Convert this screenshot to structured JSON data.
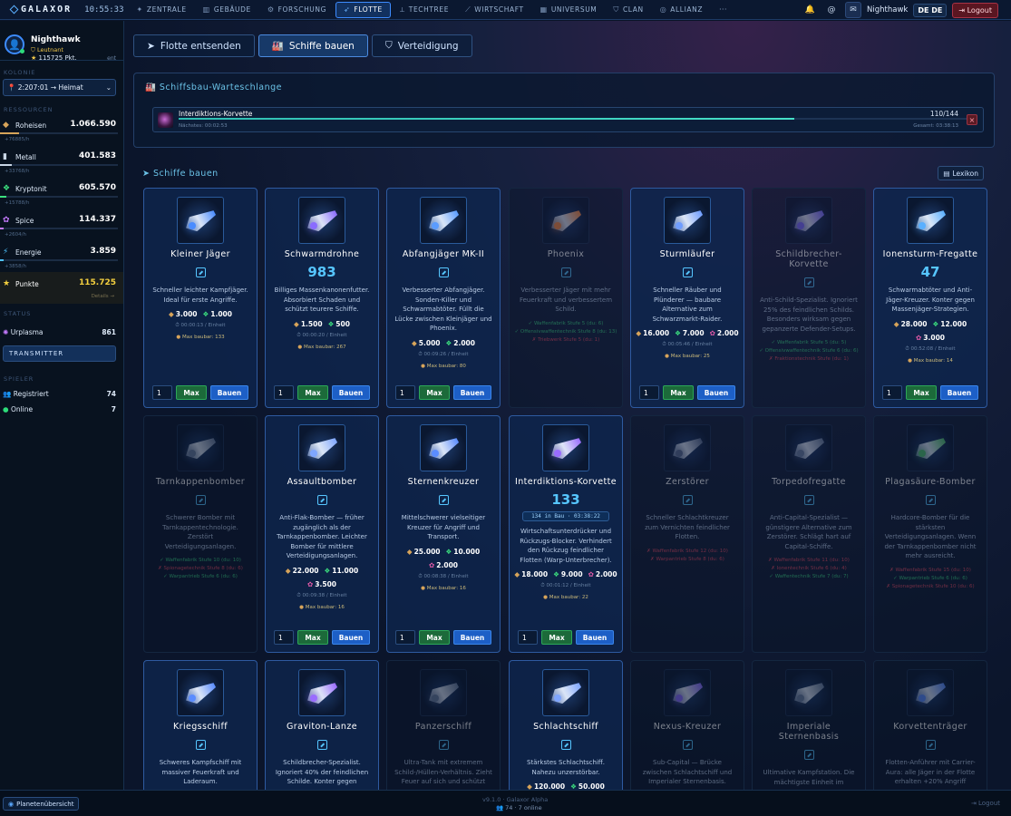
{
  "topbar": {
    "logo": "GALAXOR",
    "clock": "10:55:33",
    "nav": [
      {
        "label": "ZENTRALE",
        "icon": "radar-icon"
      },
      {
        "label": "GEBÄUDE",
        "icon": "building-icon"
      },
      {
        "label": "FORSCHUNG",
        "icon": "gear-icon"
      },
      {
        "label": "FLOTTE",
        "icon": "rocket-icon",
        "active": true
      },
      {
        "label": "TECHTREE",
        "icon": "techtree-icon"
      },
      {
        "label": "WIRTSCHAFT",
        "icon": "chart-icon"
      },
      {
        "label": "UNIVERSUM",
        "icon": "grid-icon"
      },
      {
        "label": "CLAN",
        "icon": "shield-icon"
      },
      {
        "label": "ALLIANZ",
        "icon": "globe-icon"
      }
    ],
    "more": "···",
    "username": "Nighthawk",
    "lang": "DE DE",
    "logout": "Logout"
  },
  "sidebar": {
    "player": {
      "name": "Nighthawk",
      "rank": "Leutnant",
      "points": "115725 Pkt.",
      "exp": "ent"
    },
    "colony_label": "KOLONIE",
    "colony": "2:207:01 → Heimat",
    "resources_label": "RESSOURCEN",
    "resources": [
      {
        "name": "Roheisen",
        "value": "1.066.590",
        "rate": "+76885/h",
        "fill": 0.16,
        "color": "#d7a45a"
      },
      {
        "name": "Metall",
        "value": "401.583",
        "rate": "+33768/h",
        "fill": 0.1,
        "color": "#c9d6e5"
      },
      {
        "name": "Kryptonit",
        "value": "605.570",
        "rate": "+15788/h",
        "fill": 0.05,
        "color": "#3ce07f"
      },
      {
        "name": "Spice",
        "value": "114.337",
        "rate": "+2604/h",
        "fill": 0.03,
        "color": "#c57bff"
      },
      {
        "name": "Energie",
        "value": "3.859",
        "rate": "+3858/h",
        "fill": 0.03,
        "color": "#4fc3ff"
      },
      {
        "name": "Punkte",
        "value": "115.725",
        "rate": "",
        "bonus": "Details →",
        "fill": 0,
        "color": "#f4d03f"
      }
    ],
    "status_label": "STATUS",
    "urplasma": {
      "name": "Urplasma",
      "value": "861"
    },
    "transmitter": "TRANSMITTER",
    "spieler_label": "SPIELER",
    "registered": {
      "label": "Registriert",
      "value": "74"
    },
    "online": {
      "label": "Online",
      "value": "7"
    }
  },
  "footer": {
    "planet_btn": "Planetenübersicht",
    "version": "v9.1.0 · Galaxor Alpha",
    "online": "74 · 7 online",
    "logout": "Logout"
  },
  "main": {
    "tabs": [
      "Flotte entsenden",
      "Schiffe bauen",
      "Verteidigung"
    ],
    "queue": {
      "title": "Schiffsbau-Warteschlange",
      "name": "Interdiktions-Korvette",
      "next": "Nächstes: 00:02:53",
      "count": "110/144",
      "total": "Gesamt: 03:38:13",
      "progress": 0.78
    },
    "ships_title": "Schiffe bauen",
    "lexikon": "Lexikon",
    "ships": [
      {
        "name": "Kleiner Jäger",
        "count": "0",
        "desc": "Schneller leichter Kampfjäger. Ideal für erste Angriffe.",
        "costs": [
          "3.000",
          "1.000"
        ],
        "time": "00:00:13 / Einheit",
        "max": "Max baubar: 133",
        "build": true,
        "locked": false,
        "hue": "#4a8cff"
      },
      {
        "name": "Schwarmdrohne",
        "count": "983",
        "desc": "Billiges Massenkanonenfutter. Absorbiert Schaden und schützt teurere Schiffe.",
        "costs": [
          "1.500",
          "500"
        ],
        "time": "00:00:20 / Einheit",
        "max": "Max baubar: 267",
        "build": true,
        "locked": false,
        "hue": "#8a6cff"
      },
      {
        "name": "Abfangjäger MK-II",
        "count": "0",
        "desc": "Verbesserter Abfangjäger. Sonden-Killer und Schwarmabtöter. Füllt die Lücke zwischen Kleinjäger und Phoenix.",
        "costs": [
          "5.000",
          "2.000"
        ],
        "time": "00:09:26 / Einheit",
        "max": "Max baubar: 80",
        "build": true,
        "locked": false,
        "hue": "#5a9cff"
      },
      {
        "name": "Phoenix",
        "count": "0",
        "desc": "Verbesserter Jäger mit mehr Feuerkraft und verbessertem Schild.",
        "reqs": [
          {
            "t": "✓ Waffenfabrik Stufe 5 (du: 6)",
            "ok": true
          },
          {
            "t": "✓ Offensivwaffentechnik Stufe 8 (du: 13)",
            "ok": true
          },
          {
            "t": "✗ Triebwerk Stufe 5 (du: 1)",
            "ok": false
          }
        ],
        "locked": true,
        "hue": "#ff8a3c"
      },
      {
        "name": "Sturmläufer",
        "count": "0",
        "desc": "Schneller Räuber und Plünderer — baubare Alternative zum Schwarzmarkt-Raider.",
        "costs": [
          "16.000",
          "7.000",
          "2.000"
        ],
        "time": "00:05:46 / Einheit",
        "max": "Max baubar: 25",
        "build": true,
        "locked": false,
        "hue": "#6f9dff"
      },
      {
        "name": "Schildbrecher-Korvette",
        "count": "0",
        "desc": "Anti-Schild-Spezialist. Ignoriert 25% des feindlichen Schilds. Besonders wirksam gegen gepanzerte Defender-Setups.",
        "reqs": [
          {
            "t": "✓ Waffenfabrik Stufe 5 (du: 5)",
            "ok": true
          },
          {
            "t": "✓ Offensivwaffentechnik Stufe 6 (du: 6)",
            "ok": true
          },
          {
            "t": "✗ Fraktionstechnik Stufe (du: 1)",
            "ok": false
          }
        ],
        "locked": true,
        "hue": "#7a6cff"
      },
      {
        "name": "Ionensturm-Fregatte",
        "count": "47",
        "desc": "Schwarmabtöter und Anti-Jäger-Kreuzer. Konter gegen Massenjäger-Strategien.",
        "costs": [
          "28.000",
          "12.000",
          "3.000"
        ],
        "time": "00:52:08 / Einheit",
        "max": "Max baubar: 14",
        "build": true,
        "locked": false,
        "hue": "#5ab0ff"
      },
      {
        "name": "Tarnkappenbomber",
        "count": "0",
        "desc": "Schwerer Bomber mit Tarnkappentechnologie. Zerstört Verteidigungsanlagen.",
        "reqs": [
          {
            "t": "✓ Waffenfabrik Stufe 10 (du: 10)",
            "ok": true
          },
          {
            "t": "✗ Spionagetechnik Stufe 8 (du: 6)",
            "ok": false
          },
          {
            "t": "✓ Warpantrieb Stufe 6 (du: 6)",
            "ok": true
          }
        ],
        "locked": true,
        "hue": "#6b7e9f"
      },
      {
        "name": "Assaultbomber",
        "count": "0",
        "desc": "Anti-Flak-Bomber — früher zugänglich als der Tarnkappenbomber. Leichter Bomber für mittlere Verteidigungsanlagen.",
        "costs": [
          "22.000",
          "11.000",
          "3.500"
        ],
        "time": "00:09:38 / Einheit",
        "max": "Max baubar: 16",
        "build": true,
        "locked": false,
        "hue": "#7fa6ff"
      },
      {
        "name": "Sternenkreuzer",
        "count": "0",
        "desc": "Mittelschwerer vielseitiger Kreuzer für Angriff und Transport.",
        "costs": [
          "25.000",
          "10.000",
          "2.000"
        ],
        "time": "00:08:38 / Einheit",
        "max": "Max baubar: 16",
        "build": true,
        "locked": false,
        "hue": "#5a8cff"
      },
      {
        "name": "Interdiktions-Korvette",
        "count": "133",
        "timer": "134 in Bau · 03:38:22",
        "desc": "Wirtschaftsunterdrücker und Rückzugs-Blocker. Verhindert den Rückzug feindlicher Flotten (Warp-Unterbrecher).",
        "costs": [
          "18.000",
          "9.000",
          "2.000"
        ],
        "time": "00:01:12 / Einheit",
        "max": "Max baubar: 22",
        "build": true,
        "locked": false,
        "hue": "#9a6cff"
      },
      {
        "name": "Zerstörer",
        "count": "0",
        "desc": "Schneller Schlachtkreuzer zum Vernichten feindlicher Flotten.",
        "reqs": [
          {
            "t": "✗ Waffenfabrik Stufe 12 (du: 10)",
            "ok": false
          },
          {
            "t": "✗ Warpantrieb Stufe 8 (du: 6)",
            "ok": false
          }
        ],
        "locked": true,
        "hue": "#5a6c8f"
      },
      {
        "name": "Torpedofregatte",
        "count": "0",
        "desc": "Anti-Capital-Spezialist — günstigere Alternative zum Zerstörer. Schlägt hart auf Capital-Schiffe.",
        "reqs": [
          {
            "t": "✗ Waffenfabrik Stufe 11 (du: 10)",
            "ok": false
          },
          {
            "t": "✗ Ionentechnik Stufe 6 (du: 4)",
            "ok": false
          },
          {
            "t": "✓ Waffentechnik Stufe 7 (du: 7)",
            "ok": true
          }
        ],
        "locked": true,
        "hue": "#6b7e9f"
      },
      {
        "name": "Plagasäure-Bomber",
        "count": "0",
        "desc": "Hardcore-Bomber für die stärksten Verteidigungsanlagen. Wenn der Tarnkappenbomber nicht mehr ausreicht.",
        "reqs": [
          {
            "t": "✗ Waffenfabrik Stufe 15 (du: 10)",
            "ok": false
          },
          {
            "t": "✓ Warpantrieb Stufe 6 (du: 6)",
            "ok": true
          },
          {
            "t": "✗ Spionagetechnik Stufe 10 (du: 6)",
            "ok": false
          }
        ],
        "locked": true,
        "hue": "#4fc36a"
      },
      {
        "name": "Kriegsschiff",
        "count": "0",
        "desc": "Schweres Kampfschiff mit massiver Feuerkraft und Laderaum.",
        "locked": false,
        "partial": true,
        "hue": "#5a8cff"
      },
      {
        "name": "Graviton-Lanze",
        "count": "0",
        "desc": "Schildbrecher-Spezialist. Ignoriert 40% der feindlichen Schilde. Konter gegen",
        "locked": false,
        "partial": true,
        "hue": "#9a6cff"
      },
      {
        "name": "Panzerschiff",
        "count": "0",
        "desc": "Ultra-Tank mit extremem Schild-/Hüllen-Verhältnis. Zieht Feuer auf sich und schützt",
        "locked": true,
        "hue": "#6b7e9f"
      },
      {
        "name": "Schlachtschiff",
        "count": "0",
        "desc": "Stärkstes Schlachtschiff. Nahezu unzerstörbar.",
        "costs": [
          "120.000",
          "50.000"
        ],
        "locked": false,
        "partial": true,
        "hue": "#7fa6ff"
      },
      {
        "name": "Nexus-Kreuzer",
        "count": "0",
        "desc": "Sub-Capital — Brücke zwischen Schlachtschiff und Imperialer Sternenbasis.",
        "locked": true,
        "hue": "#8a6cff"
      },
      {
        "name": "Imperiale Sternenbasis",
        "count": "0",
        "desc": "Ultimative Kampfstation. Die mächtigste Einheit im",
        "locked": true,
        "hue": "#6b7e9f"
      },
      {
        "name": "Korvettenträger",
        "count": "0",
        "desc": "Flotten-Anführer mit Carrier-Aura: alle Jäger in der Flotte erhalten +20% Angriff",
        "locked": true,
        "hue": "#5a8cff"
      }
    ]
  }
}
